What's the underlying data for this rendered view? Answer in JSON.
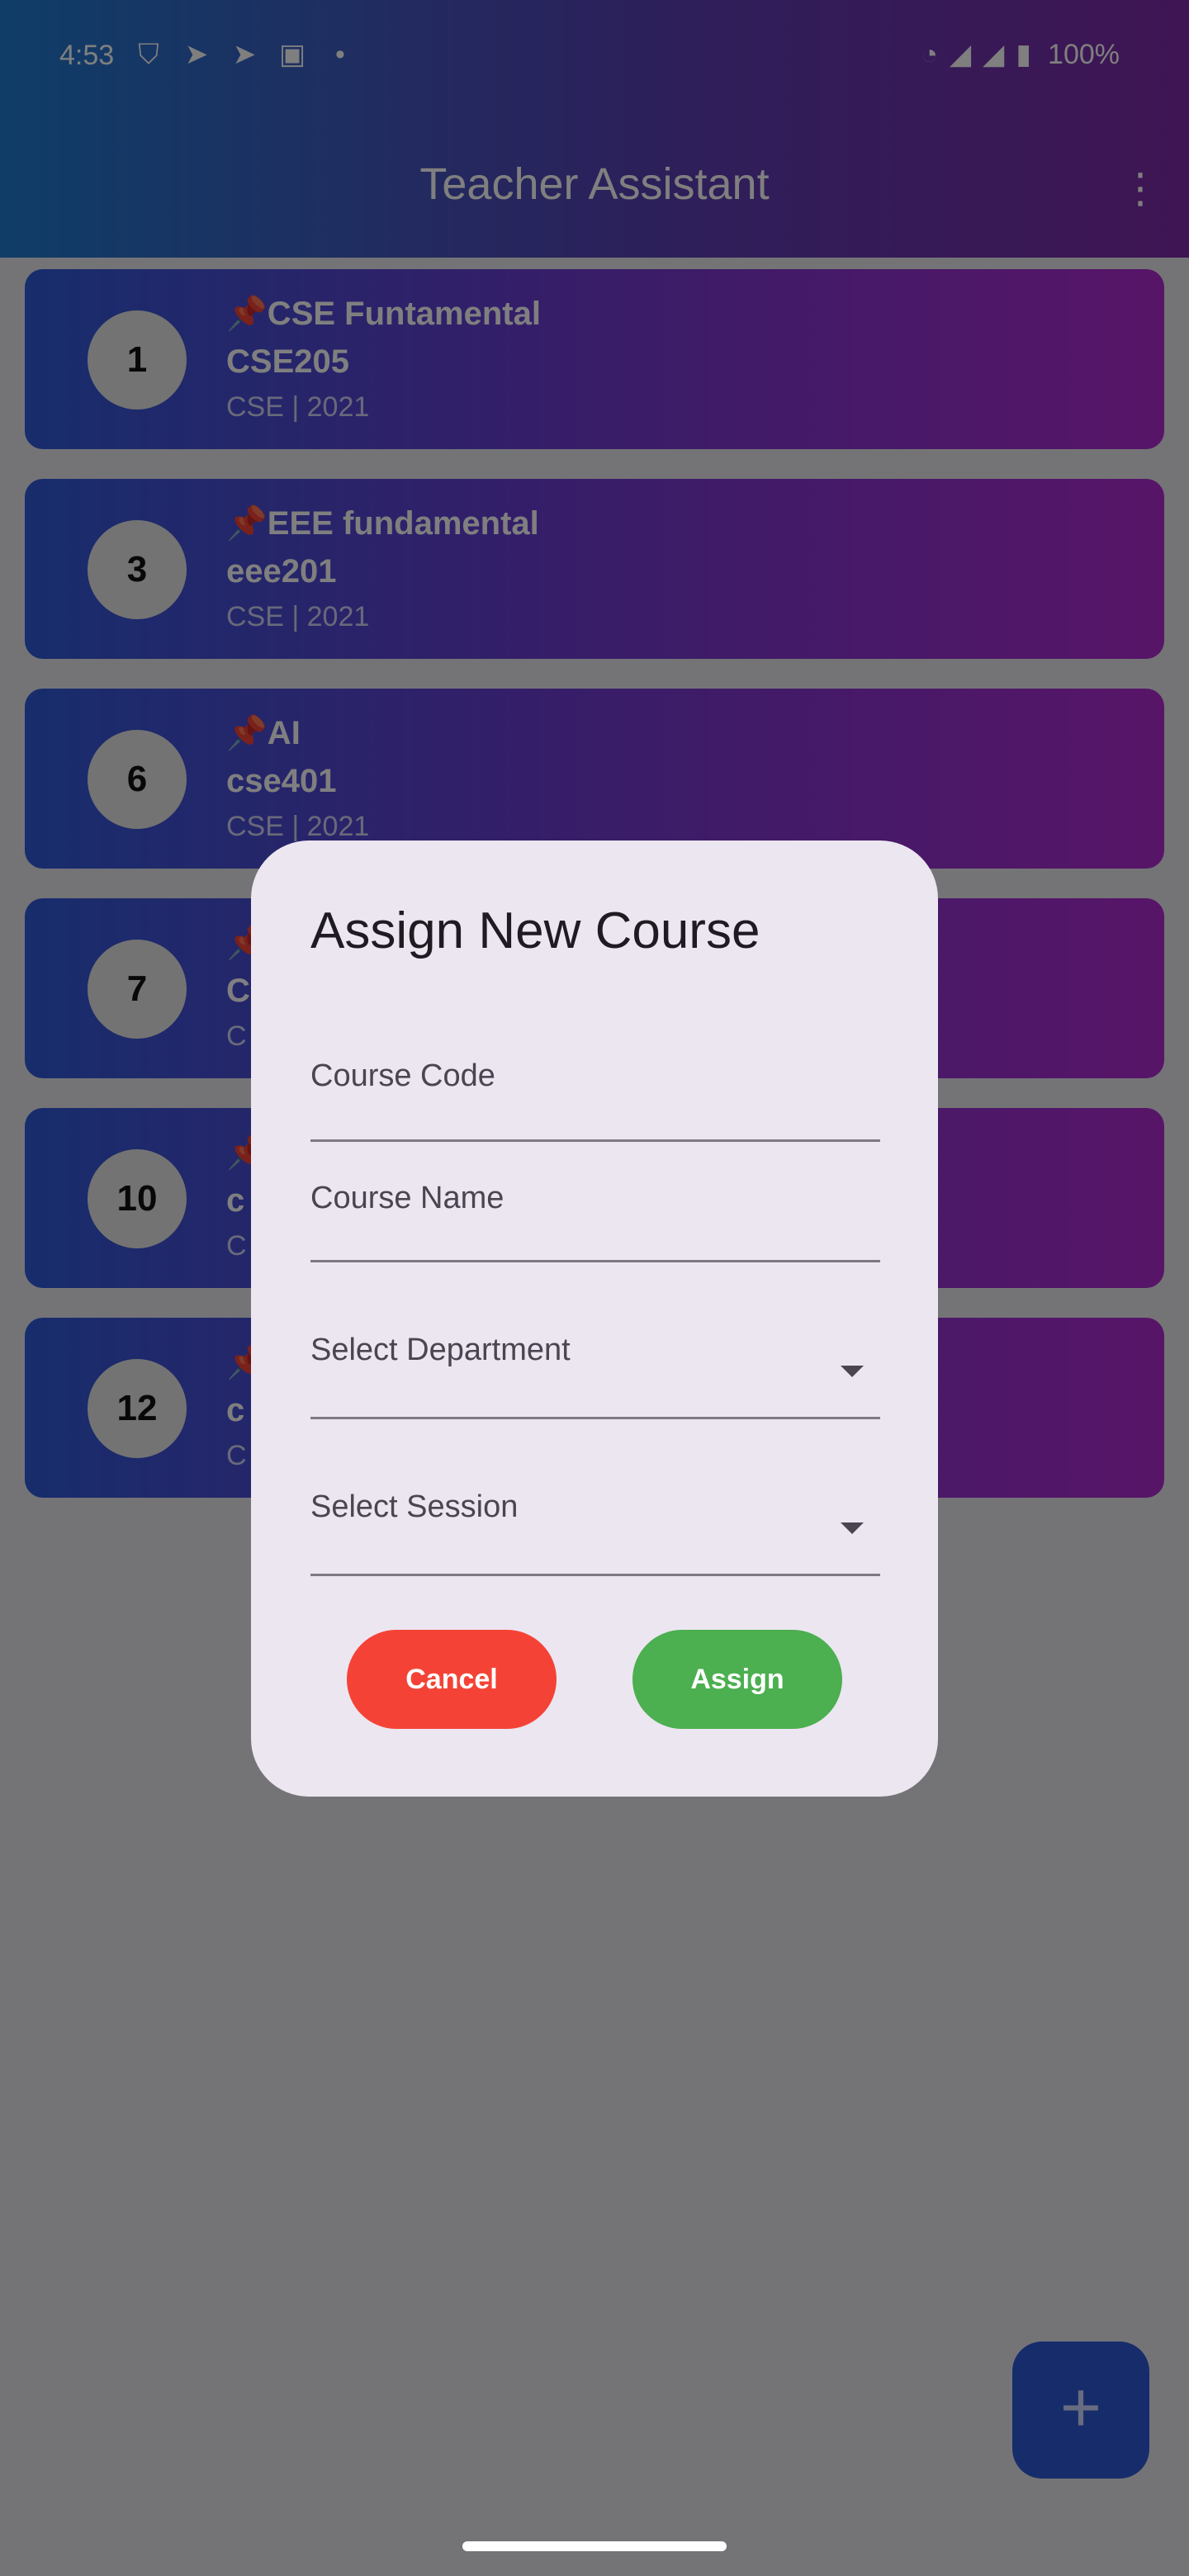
{
  "status_bar": {
    "time": "4:53",
    "left_icons": [
      "shield-icon",
      "telegram-icon",
      "telegram-icon",
      "linkedin-icon",
      "dot-icon"
    ],
    "battery": "100%"
  },
  "app_bar": {
    "title": "Teacher Assistant",
    "menu_icon": "more-vert-icon"
  },
  "courses": [
    {
      "number": "1",
      "title": "📌CSE Funtamental",
      "code": "CSE205",
      "meta": "CSE  |  2021"
    },
    {
      "number": "3",
      "title": "📌EEE fundamental",
      "code": "eee201",
      "meta": "CSE  |  2021"
    },
    {
      "number": "6",
      "title": "📌AI",
      "code": "cse401",
      "meta": "CSE  |  2021"
    },
    {
      "number": "7",
      "title": "📌",
      "code": "C",
      "meta": "C"
    },
    {
      "number": "10",
      "title": "📌",
      "code": "c",
      "meta": "C"
    },
    {
      "number": "12",
      "title": "📌",
      "code": "c",
      "meta": "C"
    }
  ],
  "dialog": {
    "title": "Assign New Course",
    "course_code_label": "Course Code",
    "course_name_label": "Course Name",
    "department_label": "Select Department",
    "session_label": "Select Session",
    "cancel_label": "Cancel",
    "assign_label": "Assign"
  },
  "fab": {
    "label": "+"
  },
  "colors": {
    "cancel": "#f44336",
    "assign": "#4caf50",
    "fab": "#2e5ad6"
  }
}
